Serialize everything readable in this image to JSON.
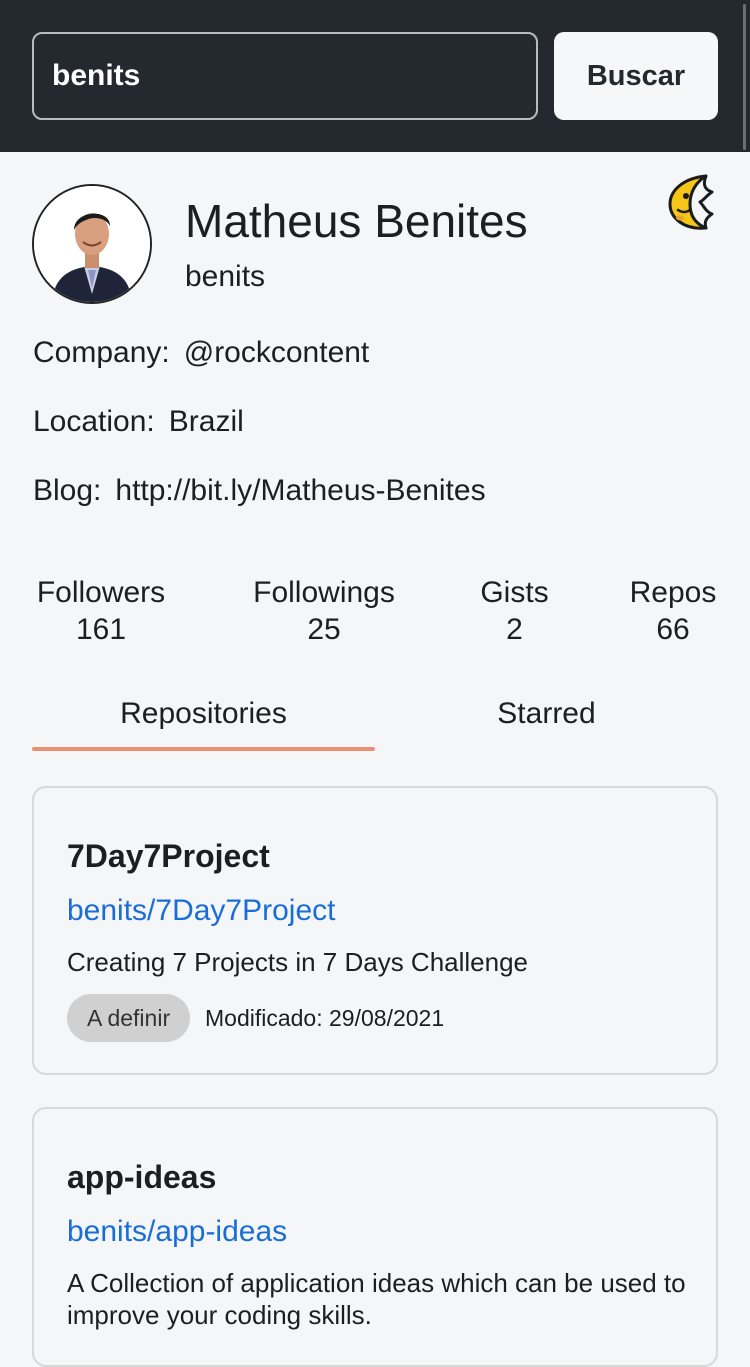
{
  "search": {
    "value": "benits",
    "button_label": "Buscar"
  },
  "profile": {
    "name": "Matheus Benites",
    "login": "benits",
    "avatar_icon": "user-avatar",
    "theme_icon": "crescent-moon-icon",
    "company_label": "Company:",
    "company": "@rockcontent",
    "location_label": "Location:",
    "location": "Brazil",
    "blog_label": "Blog:",
    "blog": "http://bit.ly/Matheus-Benites"
  },
  "stats": [
    {
      "label": "Followers",
      "value": "161"
    },
    {
      "label": "Followings",
      "value": "25"
    },
    {
      "label": "Gists",
      "value": "2"
    },
    {
      "label": "Repos",
      "value": "66"
    }
  ],
  "tabs": [
    {
      "label": "Repositories",
      "active": true
    },
    {
      "label": "Starred",
      "active": false
    }
  ],
  "repos": [
    {
      "name": "7Day7Project",
      "full_name": "benits/7Day7Project",
      "description": "Creating 7 Projects in 7 Days Challenge",
      "language": "A definir",
      "modified": "Modificado: 29/08/2021"
    },
    {
      "name": "app-ideas",
      "full_name": "benits/app-ideas",
      "description": "A Collection of application ideas which can be used to improve your coding skills."
    }
  ],
  "colors": {
    "header_bg": "#24292f",
    "accent_underline": "#ec8f72",
    "link": "#1a6dd8",
    "moon": "#f5c518"
  }
}
